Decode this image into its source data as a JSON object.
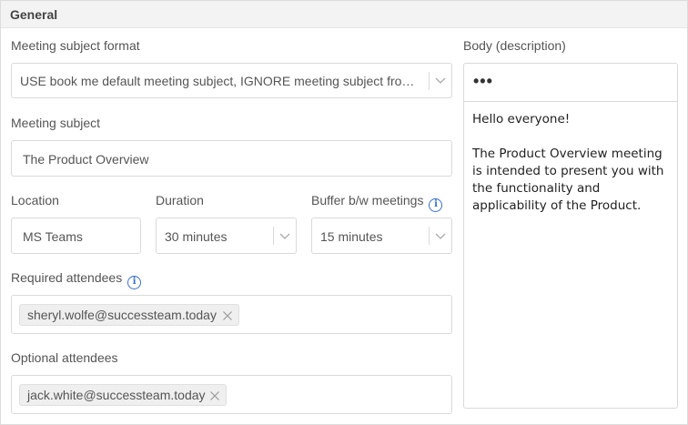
{
  "section": {
    "title": "General"
  },
  "subject_format": {
    "label": "Meeting subject format",
    "value": "USE book me default meeting subject, IGNORE meeting subject from the calendar"
  },
  "subject": {
    "label": "Meeting subject",
    "value": "The Product Overview"
  },
  "location": {
    "label": "Location",
    "value": "MS Teams"
  },
  "duration": {
    "label": "Duration",
    "value": "30 minutes"
  },
  "buffer": {
    "label": "Buffer b/w meetings",
    "value": "15 minutes"
  },
  "required_attendees": {
    "label": "Required attendees",
    "chips": [
      "sheryl.wolfe@successteam.today"
    ]
  },
  "optional_attendees": {
    "label": "Optional attendees",
    "chips": [
      "jack.white@successteam.today"
    ]
  },
  "body": {
    "label": "Body (description)",
    "toolbar_icon": "more-dots-icon",
    "text": "Hello everyone!\n\nThe Product Overview meeting is intended to present you with the functionality and applicability of the Product."
  },
  "colors": {
    "info_icon": "#3a6fd0",
    "header_bg": "#f3f3f3",
    "border": "#dadada"
  }
}
